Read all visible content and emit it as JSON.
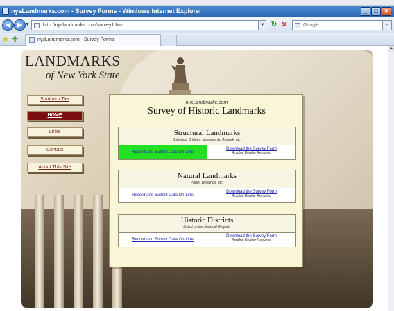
{
  "window": {
    "title": "nysLandmarks.com - Survey Forms - Windows Internet Explorer",
    "minimize": "_",
    "maximize": "□",
    "close": "✕"
  },
  "navbar": {
    "url": "http://nyslandmarks.com/survey1.htm",
    "search_placeholder": "Google",
    "back_icon": "back-arrow-icon",
    "forward_icon": "forward-arrow-icon"
  },
  "tabs": [
    {
      "label": "nysLandmarks.com - Survey Forms"
    }
  ],
  "site": {
    "title": "LANDMARKS",
    "subtitle": "of New York State"
  },
  "sidebar": {
    "items": [
      {
        "label": "Southern Tier"
      },
      {
        "label": "HOME"
      },
      {
        "label": "Links"
      },
      {
        "label": "Contact"
      },
      {
        "label": "About This Site"
      }
    ]
  },
  "panel": {
    "tagline": "nysLandmarks.com",
    "title": "Survey of Historic Landmarks",
    "sections": [
      {
        "title": "Structural Landmarks",
        "note": "Buildings, Bridges, Monuments, Artwork, etc.",
        "record_label": "Record and Submit Data On-Line",
        "download_label": "Download the Survey Form",
        "download_note": "Acrobat Reader Required"
      },
      {
        "title": "Natural Landmarks",
        "note": "Parks, Wetlands, etc.",
        "record_label": "Record and Submit Data On-Line",
        "download_label": "Download the Survey Form",
        "download_note": "Acrobat Reader Required"
      },
      {
        "title": "Historic Districts",
        "note": "Listed on the National Register",
        "record_label": "Record and Submit Data On-Line",
        "download_label": "Download the Survey Form",
        "download_note": "Acrobat Reader Required"
      }
    ]
  },
  "colors": {
    "home_button": "#7c0f0f",
    "highlight_link": "#22e022",
    "panel_bg": "#f8f6d6"
  }
}
